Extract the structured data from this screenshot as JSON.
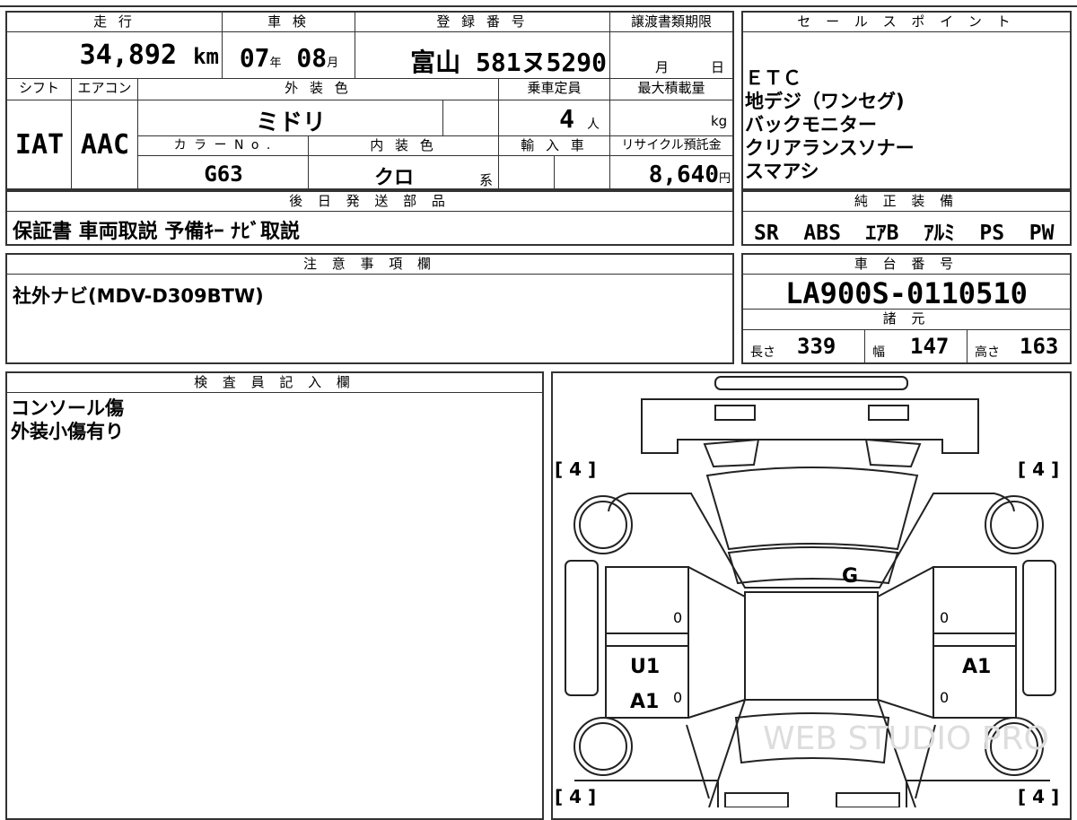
{
  "basic": {
    "mileage_label": "走 行",
    "mileage_value": "34,892",
    "mileage_unit": "km",
    "inspection_label": "車 検",
    "inspection_year": "07",
    "inspection_year_unit": "年",
    "inspection_month": "08",
    "inspection_month_unit": "月",
    "reg_label": "登 録 番 号",
    "reg_value": "富山 581ヌ5290",
    "transfer_label": "譲渡書類期限",
    "transfer_month": "月",
    "transfer_day": "日"
  },
  "spec": {
    "shift_label": "シフト",
    "aircon_label": "エアコン",
    "shift_value": "IAT",
    "aircon_value": "AAC",
    "ext_color_label": "外 装 色",
    "ext_color_value": "ミドリ",
    "capacity_label": "乗車定員",
    "capacity_value": "4",
    "capacity_unit": "人",
    "load_label": "最大積載量",
    "load_unit": "kg",
    "color_no_label": "カ ラ ー N o .",
    "color_no_value": "G63",
    "int_color_label": "内 装 色",
    "int_color_value": "クロ",
    "int_color_suffix": "系",
    "import_label": "輸 入 車",
    "recycle_label": "リサイクル預託金",
    "recycle_value": "8,640",
    "recycle_unit": "円"
  },
  "later_parts": {
    "label": "後 日 発 送 部 品",
    "value": "保証書 車両取説 予備ｷｰ ﾅﾋﾞ取説"
  },
  "sales_points": {
    "label": "セ ー ル ス ポ イ ン ト",
    "items": [
      "ＥＴＣ",
      "地デジ（ワンセグ)",
      "バックモニター",
      "クリアランスソナー",
      "スマアシ"
    ]
  },
  "genuine_equipment": {
    "label": "純 正 装 備",
    "value": "SR  ABS  ｴｱB  ｱﾙﾐ  PS  PW"
  },
  "notes": {
    "label": "注 意 事 項 欄",
    "value": "社外ナビ(MDV-D309BTW)"
  },
  "chassis": {
    "label": "車 台 番 号",
    "value": "LA900S-0110510"
  },
  "dimensions": {
    "label": "諸 元",
    "length_label": "長さ",
    "length_value": "339",
    "width_label": "幅",
    "width_value": "147",
    "height_label": "高さ",
    "height_value": "163"
  },
  "inspector": {
    "label": "検 査 員 記 入 欄",
    "lines": [
      "コンソール傷",
      "外装小傷有り"
    ]
  },
  "diagram": {
    "tire_fl": "[ 4 ]",
    "tire_fr": "[ 4 ]",
    "tire_rl": "[ 4 ]",
    "tire_rr": "[ 4 ]",
    "mark_roof": "G",
    "mark_left_door_1": "U1",
    "mark_left_door_2": "A1",
    "mark_right_door": "A1",
    "zero": "0",
    "watermark": "WEB STUDIO PRO"
  }
}
